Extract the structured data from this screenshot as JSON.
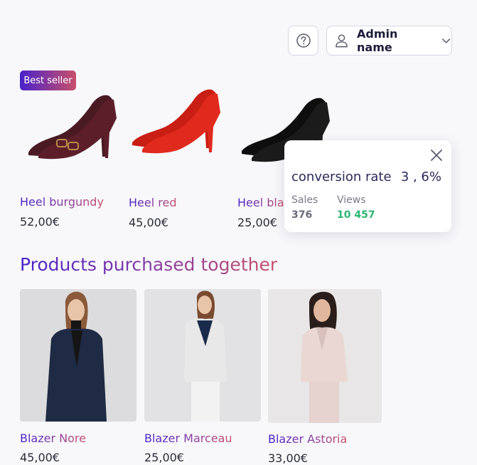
{
  "header": {
    "help_icon": "question-circle-icon",
    "user_icon": "user-icon",
    "admin_name": "Admin name",
    "chevron_icon": "chevron-down-icon"
  },
  "best_seller_badge": "Best seller",
  "shoes": [
    {
      "name": "Heel burgundy",
      "price": "52,00€",
      "color": "#4a1a22"
    },
    {
      "name": "Heel red",
      "price": "45,00€",
      "color": "#d8261c"
    },
    {
      "name": "Heel bla",
      "price": "25,00€",
      "color": "#111111"
    }
  ],
  "tooltip": {
    "label": "conversion rate",
    "value": "3 , 6%",
    "sales_label": "Sales",
    "sales_value": "376",
    "views_label": "Views",
    "views_value": "10 457",
    "close_icon": "close-icon"
  },
  "section_title": "Products purchased together",
  "blazers": [
    {
      "name": "Blazer Nore",
      "price": "45,00€",
      "color": "#1f2a44"
    },
    {
      "name": "Blazer Marceau",
      "price": "25,00€",
      "color": "#dcdcdc"
    },
    {
      "name": "Blazer Astoria",
      "price": "33,00€",
      "color": "#ead7d3"
    }
  ],
  "colors": {
    "accent_start": "#4a22c9",
    "accent_end": "#c8506a",
    "views_green": "#2bb673"
  }
}
